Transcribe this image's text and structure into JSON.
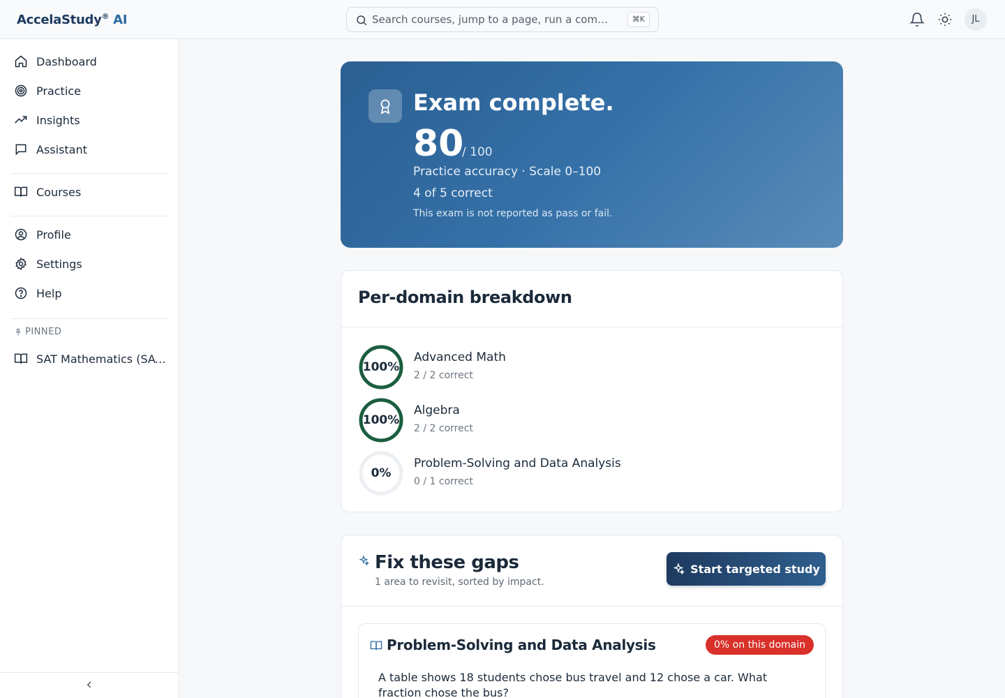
{
  "brand": {
    "name": "AccelaStudy",
    "reg": "®",
    "ai": "AI"
  },
  "search": {
    "placeholder": "Search courses, jump to a page, run a comma…",
    "shortcut": "⌘K"
  },
  "user": {
    "initials": "JL"
  },
  "sidebar": {
    "items": [
      {
        "label": "Dashboard",
        "icon": "home-icon"
      },
      {
        "label": "Practice",
        "icon": "target-icon"
      },
      {
        "label": "Insights",
        "icon": "trending-up-icon"
      },
      {
        "label": "Assistant",
        "icon": "chat-icon"
      },
      {
        "label": "Courses",
        "icon": "book-open-icon"
      },
      {
        "label": "Profile",
        "icon": "user-circle-icon"
      },
      {
        "label": "Settings",
        "icon": "gear-icon"
      },
      {
        "label": "Help",
        "icon": "help-circle-icon"
      }
    ],
    "pinned_heading": "PINNED",
    "pinned": [
      {
        "label": "SAT Mathematics (SAT…",
        "icon": "book-open-icon"
      }
    ]
  },
  "hero": {
    "title": "Exam complete.",
    "score": "80",
    "out_of": "/ 100",
    "subtitle": "Practice accuracy · Scale 0–100",
    "correct": "4 of 5 correct",
    "note": "This exam is not reported as pass or fail."
  },
  "breakdown": {
    "heading": "Per-domain breakdown",
    "domains": [
      {
        "name": "Advanced Math",
        "pct_label": "100%",
        "pct": 1.0,
        "detail": "2 / 2 correct"
      },
      {
        "name": "Algebra",
        "pct_label": "100%",
        "pct": 1.0,
        "detail": "2 / 2 correct"
      },
      {
        "name": "Problem-Solving and Data Analysis",
        "pct_label": "0%",
        "pct": 0.0,
        "detail": "0 / 1 correct"
      }
    ]
  },
  "gaps": {
    "heading": "Fix these gaps",
    "subtitle": "1 area to revisit, sorted by impact.",
    "button": "Start targeted study",
    "items": [
      {
        "title": "Problem-Solving and Data Analysis",
        "badge": "0% on this domain",
        "question": "A table shows 18 students chose bus travel and 12 chose a car. What fraction chose the bus?"
      }
    ]
  },
  "colors": {
    "accent": "#1e3a5f",
    "ring_full": "#1a5e3f",
    "ring_empty": "#eceff2",
    "danger": "#d9302a"
  }
}
